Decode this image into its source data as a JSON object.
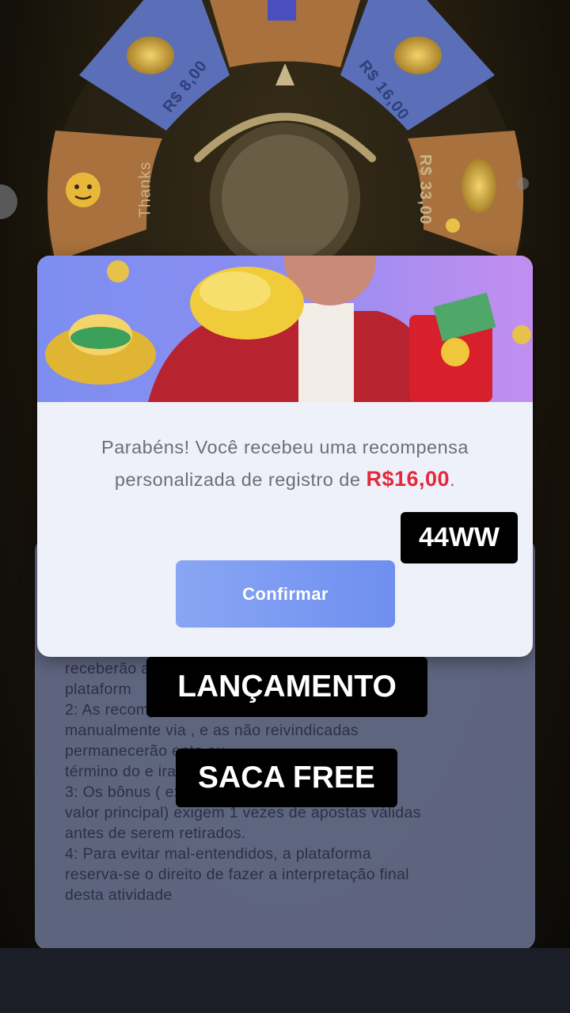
{
  "wheel": {
    "segments": [
      {
        "label": "R$ 8,00"
      },
      {
        "label": "R$ 16,00"
      },
      {
        "label": "R$ 33,00"
      },
      {
        "label": "Thanks"
      }
    ]
  },
  "rules": {
    "text": "receberão                                        a\nplataform\n2: As recompensas                              as\nmanualmente via , e as não reivindicadas\npermanecerão                                    ento ou\ntérmino do e                                 irarão.\n3: Os bônus (                            excluindo o\nvalor principal) exigem 1 vezes de apostas válidas\nantes de serem retirados.\n4: Para evitar mal-entendidos, a plataforma\nreserva-se o direito de fazer a interpretação final\ndesta atividade"
  },
  "modal": {
    "message_prefix": "Parabéns! Você recebeu uma recompensa personalizada de registro de ",
    "amount": "R$16,00",
    "message_suffix": ".",
    "confirm_label": "Confirmar"
  },
  "captions": {
    "code": "44WW",
    "launch": "LANÇAMENTO",
    "free": "SACA FREE"
  },
  "colors": {
    "amount": "#e3293a",
    "button": "#7b99f2",
    "banner": "#8a8df2"
  }
}
